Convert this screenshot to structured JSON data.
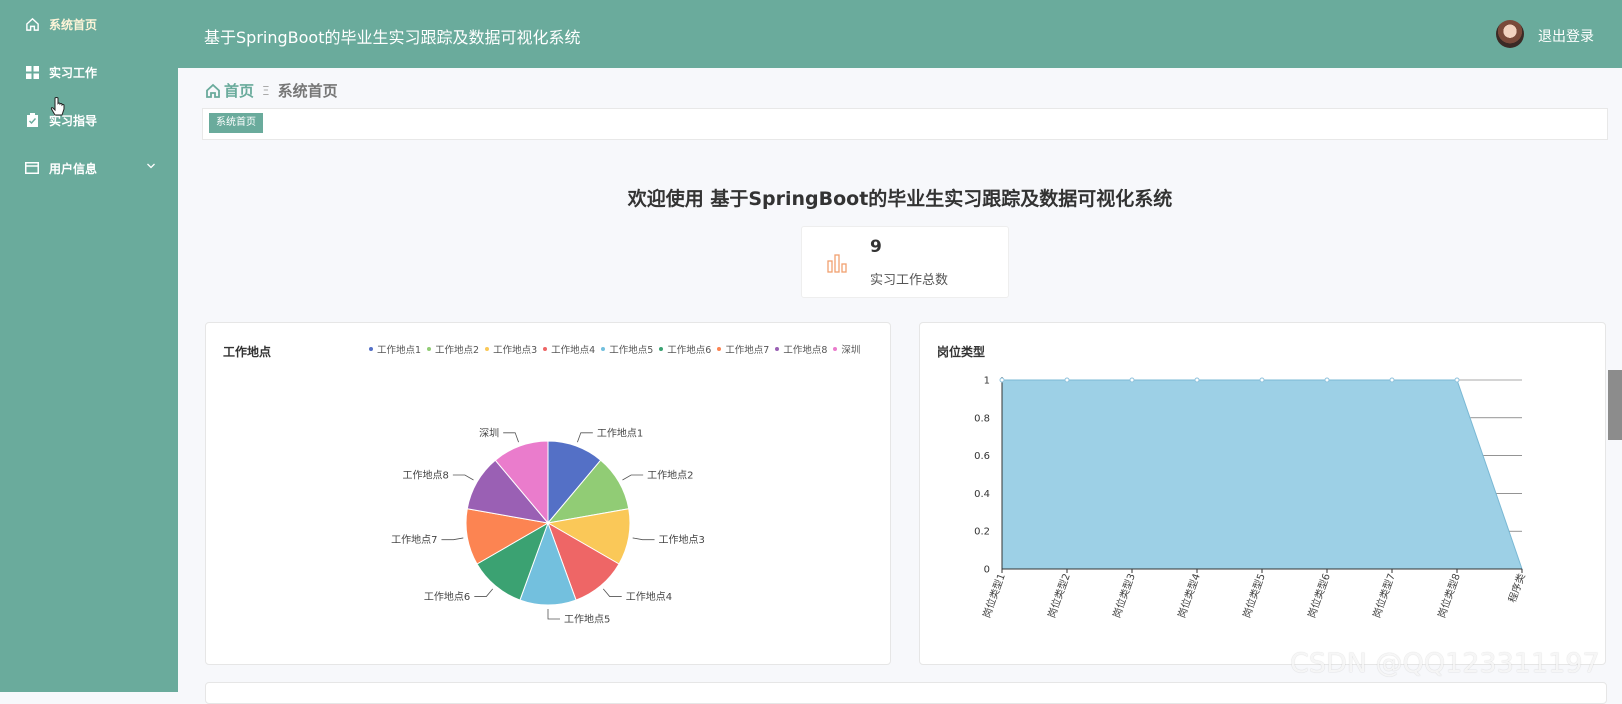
{
  "sidebar": {
    "items": [
      {
        "label": "系统首页",
        "icon": "home-icon",
        "active": true
      },
      {
        "label": "实习工作",
        "icon": "grid-icon"
      },
      {
        "label": "实习指导",
        "icon": "clipboard-icon"
      },
      {
        "label": "用户信息",
        "icon": "card-icon",
        "has_submenu": true
      }
    ]
  },
  "header": {
    "title": "基于SpringBoot的毕业生实习跟踪及数据可视化系统",
    "logout_label": "退出登录"
  },
  "breadcrumb": {
    "home": "首页",
    "separator": "Ξ",
    "current": "系统首页"
  },
  "tags": [
    "系统首页"
  ],
  "welcome": "欢迎使用 基于SpringBoot的毕业生实习跟踪及数据可视化系统",
  "stat": {
    "value": "9",
    "label": "实习工作总数"
  },
  "colors": {
    "accent": "#6aab9c",
    "area": "#9dd0e6"
  },
  "watermark": "CSDN @QQ123311197",
  "chart_data": [
    {
      "type": "pie",
      "title": "工作地点",
      "legend_position": "top-right",
      "categories": [
        "工作地点1",
        "工作地点2",
        "工作地点3",
        "工作地点4",
        "工作地点5",
        "工作地点6",
        "工作地点7",
        "工作地点8",
        "深圳"
      ],
      "values": [
        1,
        1,
        1,
        1,
        1,
        1,
        1,
        1,
        1
      ],
      "colors": [
        "#5470c6",
        "#91cc75",
        "#fac858",
        "#ee6666",
        "#73c0de",
        "#3ba272",
        "#fc8452",
        "#9a60b4",
        "#ea7ccc"
      ]
    },
    {
      "type": "area",
      "title": "岗位类型",
      "categories": [
        "岗位类型1",
        "岗位类型2",
        "岗位类型3",
        "岗位类型4",
        "岗位类型5",
        "岗位类型6",
        "岗位类型7",
        "岗位类型8",
        "程序类"
      ],
      "values": [
        1,
        1,
        1,
        1,
        1,
        1,
        1,
        1,
        0
      ],
      "ylim": [
        0,
        1
      ],
      "yticks": [
        "0",
        "0.2",
        "0.4",
        "0.6",
        "0.8",
        "1"
      ],
      "grid": true
    }
  ]
}
